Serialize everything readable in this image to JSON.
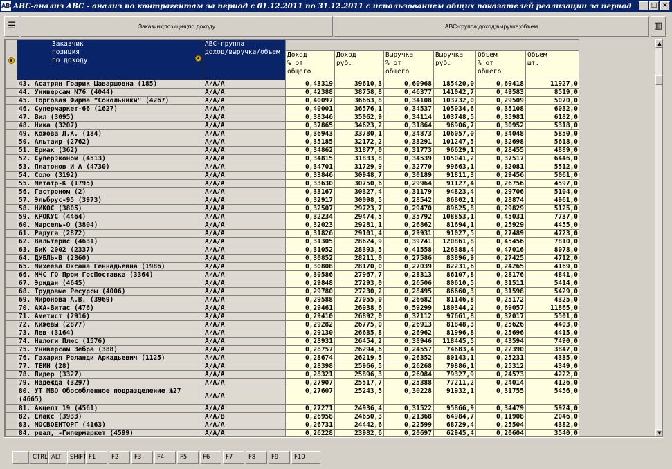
{
  "window": {
    "title": "ABC-анализ ABC - анализ по контрагентам за период с 01.12.2011 по 31.12.2011 с использованием общих показателей реализации за период",
    "app_icon": "ABC",
    "min": "_",
    "max": "□",
    "close": "×"
  },
  "header": {
    "left_panel": "Заказчик;позиция;по доходу",
    "right_panel": "ABC-группа;доход;выручка;объем",
    "left_button_icon": "list-icon",
    "right_button_icon": "grid-icon"
  },
  "columns": {
    "name": "Заказчик\nпозиция\nпо доходу",
    "group": "ABC-группа\nдоход/выручка/объем",
    "income_pct": "Доход\n% от\nобщего",
    "income_rub": "Доход\nруб.",
    "revenue_pct": "Выручка\n% от\nобщего",
    "revenue_rub": "Выручка\nруб.",
    "volume_pct": "Объем\n% от\nобщего",
    "volume_qty": "Объем\nшт."
  },
  "rows": [
    [
      "43. Асатрян Гоарик Шаваршовна (185)",
      "A/A/A",
      "0,43319",
      "39610,3",
      "0,60968",
      "185420,0",
      "0,69418",
      "11927,0"
    ],
    [
      "44. Универсам N76 (4044)",
      "A/A/A",
      "0,42388",
      "38758,8",
      "0,46377",
      "141042,7",
      "0,49583",
      "8519,0"
    ],
    [
      "45. Торговая Фирма \"Сокольники\" (4267)",
      "A/A/A",
      "0,40097",
      "36663,8",
      "0,34108",
      "103732,0",
      "0,29509",
      "5070,0"
    ],
    [
      "46. Супермаркет-66 (1627)",
      "A/A/A",
      "0,40001",
      "36576,1",
      "0,34537",
      "105034,6",
      "0,35108",
      "6032,0"
    ],
    [
      "47. Вил (3095)",
      "A/A/A",
      "0,38346",
      "35062,9",
      "0,34114",
      "103748,5",
      "0,35981",
      "6182,0"
    ],
    [
      "48. Ника (3207)",
      "A/A/A",
      "0,37865",
      "34623,2",
      "0,31864",
      "96906,7",
      "0,30952",
      "5318,0"
    ],
    [
      "49. Кожова Л.К. (184)",
      "A/A/A",
      "0,36943",
      "33780,1",
      "0,34873",
      "106057,0",
      "0,34048",
      "5850,0"
    ],
    [
      "50. Альтаир (2762)",
      "A/A/A",
      "0,35185",
      "32172,2",
      "0,33291",
      "101247,5",
      "0,32698",
      "5618,0"
    ],
    [
      "51. Ермак (362)",
      "A/A/A",
      "0,34862",
      "31877,0",
      "0,31773",
      "96629,1",
      "0,28455",
      "4889,0"
    ],
    [
      "52. СуперЭконом (4513)",
      "A/A/A",
      "0,34815",
      "31833,8",
      "0,34539",
      "105041,2",
      "0,37517",
      "6446,0"
    ],
    [
      "53. Платонов И А (4730)",
      "A/A/A",
      "0,34701",
      "31729,9",
      "0,32770",
      "99663,1",
      "0,32081",
      "5512,0"
    ],
    [
      "54. Соло (3192)",
      "A/A/A",
      "0,33846",
      "30948,7",
      "0,30189",
      "91811,3",
      "0,29456",
      "5061,0"
    ],
    [
      "55. Метатр-К (1795)",
      "A/A/A",
      "0,33630",
      "30750,6",
      "0,29964",
      "91127,4",
      "0,26756",
      "4597,0"
    ],
    [
      "56. Гастроном (2)",
      "A/A/A",
      "0,33167",
      "30327,4",
      "0,31179",
      "94823,4",
      "0,29706",
      "5104,0"
    ],
    [
      "57. Эльбрус-95 (3973)",
      "A/A/A",
      "0,32917",
      "30098,5",
      "0,28542",
      "86802,1",
      "0,28874",
      "4961,0"
    ],
    [
      "58. НИКОС (3805)",
      "A/A/A",
      "0,32507",
      "29723,7",
      "0,29470",
      "89625,8",
      "0,29829",
      "5125,0"
    ],
    [
      "59. КРОКУС (4464)",
      "A/A/A",
      "0,32234",
      "29474,5",
      "0,35792",
      "108853,1",
      "0,45031",
      "7737,0"
    ],
    [
      "60. Марсель-О (3804)",
      "A/A/A",
      "0,32023",
      "29281,1",
      "0,26862",
      "81694,1",
      "0,25929",
      "4455,0"
    ],
    [
      "61. Радуга (2872)",
      "A/A/A",
      "0,31826",
      "29101,4",
      "0,29931",
      "91027,5",
      "0,27489",
      "4723,0"
    ],
    [
      "62. Вальтерис (4631)",
      "A/A/A",
      "0,31305",
      "28624,9",
      "0,39741",
      "120861,8",
      "0,45456",
      "7810,0"
    ],
    [
      "63. БиК 2002 (2337)",
      "A/A/A",
      "0,31052",
      "28393,5",
      "0,41558",
      "126388,4",
      "0,47016",
      "8078,0"
    ],
    [
      "64. ДУБЛЬ-В (2860)",
      "A/A/A",
      "0,30852",
      "28211,0",
      "0,27586",
      "83896,9",
      "0,27425",
      "4712,0"
    ],
    [
      "65. Михеева Оксана Геннадьевна (1986)",
      "A/A/A",
      "0,30808",
      "28170,0",
      "0,27039",
      "82231,6",
      "0,24265",
      "4169,0"
    ],
    [
      "66. МЧС ГО Пром ГосПоставка (3364)",
      "A/A/A",
      "0,30586",
      "27967,7",
      "0,28313",
      "86107,8",
      "0,28176",
      "4841,0"
    ],
    [
      "67. Эридан (4645)",
      "A/A/A",
      "0,29848",
      "27293,0",
      "0,26506",
      "80610,5",
      "0,31511",
      "5414,0"
    ],
    [
      "68. Трудовые Ресурсы (4006)",
      "A/A/A",
      "0,29780",
      "27230,2",
      "0,28495",
      "86660,3",
      "0,31598",
      "5429,0"
    ],
    [
      "69. Миронова А.В. (3969)",
      "A/A/A",
      "0,29588",
      "27055,0",
      "0,26682",
      "81146,8",
      "0,25172",
      "4325,0"
    ],
    [
      "70. АХА-Витас (476)",
      "A/A/A",
      "0,29461",
      "26938,6",
      "0,59299",
      "180344,2",
      "0,69057",
      "11865,0"
    ],
    [
      "71. Аметист (2916)",
      "A/A/A",
      "0,29410",
      "26892,0",
      "0,32112",
      "97661,8",
      "0,32017",
      "5501,0"
    ],
    [
      "72. Кижевы (2877)",
      "A/A/A",
      "0,29282",
      "26775,0",
      "0,26913",
      "81848,3",
      "0,25626",
      "4403,0"
    ],
    [
      "73. Лев (3164)",
      "A/A/A",
      "0,29130",
      "26635,8",
      "0,26962",
      "81996,8",
      "0,25696",
      "4415,0"
    ],
    [
      "74. Налоги Плюс (1576)",
      "A/A/A",
      "0,28931",
      "26454,2",
      "0,38946",
      "118445,5",
      "0,43594",
      "7490,0"
    ],
    [
      "75. Универсам Зебра (388)",
      "A/A/A",
      "0,28757",
      "26294,6",
      "0,24557",
      "74683,4",
      "0,22390",
      "3847,0"
    ],
    [
      "76. Гахария Роланди Аркадьевич (1125)",
      "A/A/A",
      "0,28674",
      "26219,5",
      "0,26352",
      "80143,1",
      "0,25231",
      "4335,0"
    ],
    [
      "77. ТЕЙН (28)",
      "A/A/A",
      "0,28398",
      "25966,5",
      "0,26268",
      "79886,1",
      "0,25312",
      "4349,0"
    ],
    [
      "78. Лидер (3327)",
      "A/A/A",
      "0,28321",
      "25896,3",
      "0,26084",
      "79327,9",
      "0,24573",
      "4222,0"
    ],
    [
      "79. Надежда (3297)",
      "A/A/A",
      "0,27907",
      "25517,7",
      "0,25388",
      "77211,2",
      "0,24014",
      "4126,0"
    ],
    [
      "80. УТ МВО Обособленное подразделение №27 (4665)",
      "A/A/A",
      "0,27607",
      "25243,5",
      "0,30228",
      "91932,1",
      "0,31755",
      "5456,0"
    ],
    [
      "81. Акцепт 19 (4561)",
      "A/A/A",
      "0,27271",
      "24936,4",
      "0,31522",
      "95866,9",
      "0,34479",
      "5924,0"
    ],
    [
      "82. Елакс (3933)",
      "A/A/B",
      "0,26958",
      "24650,3",
      "0,21368",
      "64984,7",
      "0,11908",
      "2046,0"
    ],
    [
      "83. МОСВОЕНТОРГ (4163)",
      "A/A/A",
      "0,26731",
      "24442,6",
      "0,22599",
      "68729,4",
      "0,25504",
      "4382,0"
    ],
    [
      "84. реал, -Гипермаркет (4599)",
      "A/A/A",
      "0,26228",
      "23982,6",
      "0,20697",
      "62945,4",
      "0,20604",
      "3540,0"
    ]
  ],
  "fkeys": {
    "ctrl": "CTRL",
    "alt": "ALT",
    "shift": "SHIFT",
    "f1": "F1",
    "f2": "F2",
    "f3": "F3",
    "f4": "F4",
    "f5": "F5",
    "f6": "F6",
    "f7": "F7",
    "f8": "F8",
    "f9": "F9",
    "f10": "F10"
  }
}
